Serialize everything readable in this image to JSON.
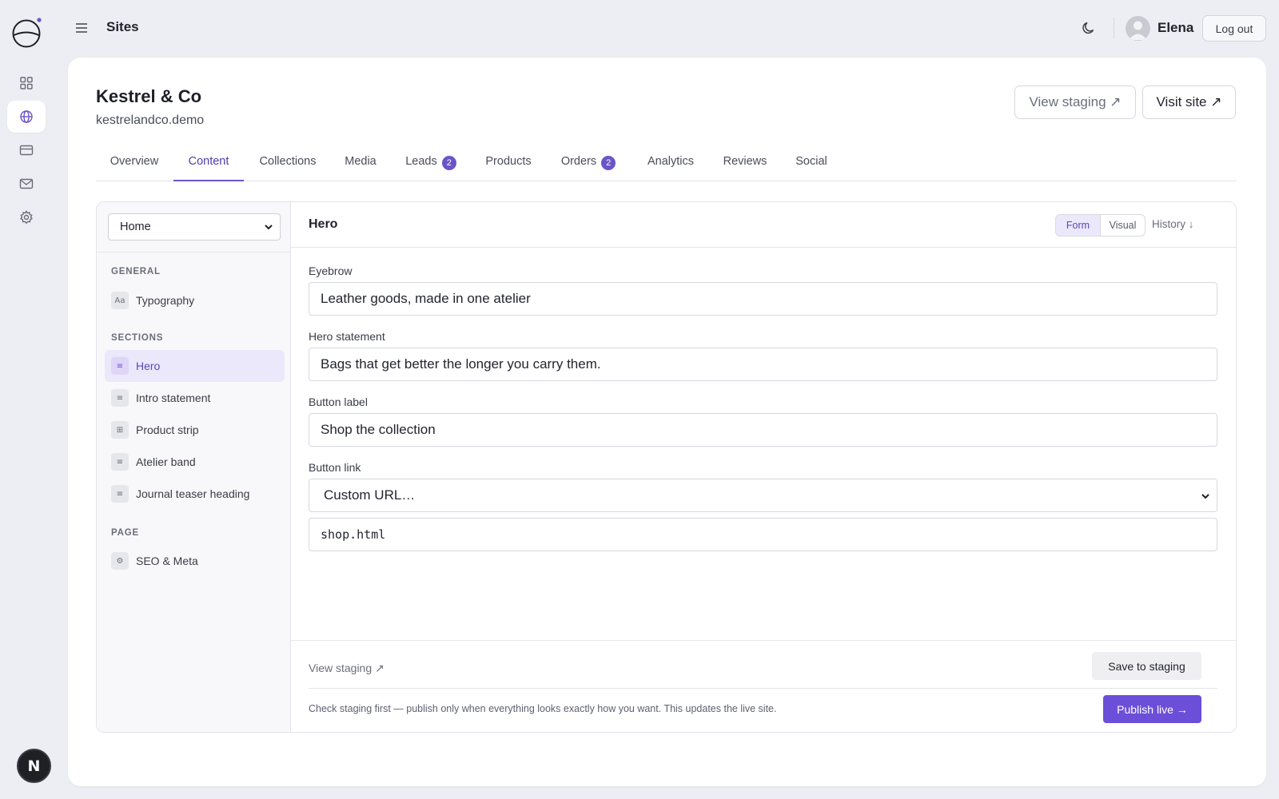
{
  "app": {
    "title": "Sites",
    "user": {
      "name": "Elena",
      "logout_label": "Log out"
    },
    "brand_badge": "N",
    "accent_color": "#6b55c9"
  },
  "rail": {
    "items": [
      {
        "icon": "dashboard-grid-icon",
        "active": false
      },
      {
        "icon": "globe-icon",
        "active": true
      },
      {
        "icon": "credit-card-icon",
        "active": false
      },
      {
        "icon": "mail-icon",
        "active": false
      },
      {
        "icon": "gear-icon",
        "active": false
      }
    ]
  },
  "site": {
    "name": "Kestrel & Co",
    "domain": "kestrelandco.demo",
    "view_staging_label": "View staging ↗",
    "visit_site_label": "Visit site ↗"
  },
  "tabs": [
    {
      "label": "Overview",
      "active": false
    },
    {
      "label": "Content",
      "active": true
    },
    {
      "label": "Collections",
      "active": false
    },
    {
      "label": "Media",
      "active": false
    },
    {
      "label": "Leads",
      "count": "2",
      "active": false
    },
    {
      "label": "Products",
      "active": false
    },
    {
      "label": "Orders",
      "count": "2",
      "active": false
    },
    {
      "label": "Analytics",
      "active": false
    },
    {
      "label": "Reviews",
      "active": false
    },
    {
      "label": "Social",
      "active": false
    }
  ],
  "sidebar": {
    "page_select": "Home",
    "general_heading": "GENERAL",
    "general_items": [
      {
        "glyph": "Aa",
        "label": "Typography"
      }
    ],
    "sections_heading": "SECTIONS",
    "section_items": [
      {
        "glyph": "≡",
        "label": "Hero",
        "active": true
      },
      {
        "glyph": "≡",
        "label": "Intro statement"
      },
      {
        "glyph": "⊞",
        "label": "Product strip"
      },
      {
        "glyph": "≡",
        "label": "Atelier band"
      },
      {
        "glyph": "≡",
        "label": "Journal teaser heading"
      }
    ],
    "page_heading": "PAGE",
    "page_items": [
      {
        "glyph": "⚙",
        "label": "SEO & Meta"
      }
    ]
  },
  "form": {
    "title": "Hero",
    "mode_form": "Form",
    "mode_visual": "Visual",
    "history_label": "History ↓",
    "fields": {
      "eyebrow_label": "Eyebrow",
      "eyebrow_value": "Leather goods, made in one atelier",
      "statement_label": "Hero statement",
      "statement_value": "Bags that get better the longer you carry them.",
      "button_label_label": "Button label",
      "button_label_value": "Shop the collection",
      "button_link_label": "Button link",
      "button_link_select": "Custom URL…",
      "button_link_url": "shop.html"
    },
    "footer": {
      "view_staging": "View staging ↗",
      "save_label": "Save to staging",
      "note": "Check staging first — publish only when everything looks exactly how you want. This updates the live site.",
      "publish_label": "Publish live →"
    }
  }
}
